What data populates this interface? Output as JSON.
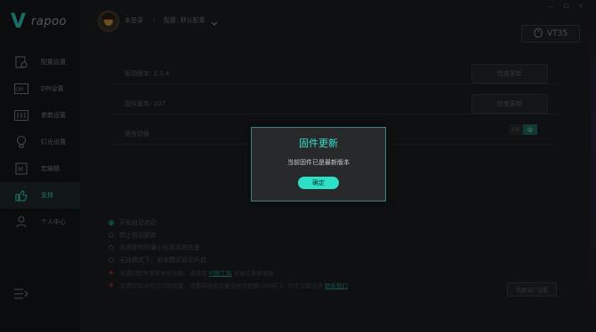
{
  "brand": {
    "logo_letter": "V",
    "logo_text": "rapoo"
  },
  "sidebar": {
    "items": [
      {
        "label": "配置设置",
        "icon": "config-icon",
        "active": false
      },
      {
        "label": "DPI设置",
        "icon": "dpi-icon",
        "active": false
      },
      {
        "label": "参数设置",
        "icon": "params-icon",
        "active": false
      },
      {
        "label": "灯光设置",
        "icon": "light-icon",
        "active": false
      },
      {
        "label": "宏编辑",
        "icon": "macro-icon",
        "active": false
      },
      {
        "label": "支持",
        "icon": "thumbs-up-icon",
        "active": true
      },
      {
        "label": "个人中心",
        "icon": "user-icon",
        "active": false
      }
    ],
    "bottom_icon": "menu-icon"
  },
  "topbar": {
    "username": "未登录",
    "separator": "|",
    "config_label": "配置: 默认配置",
    "window_controls": {
      "minimize": "—",
      "restore": "口",
      "close": "✕"
    },
    "device_name": "VT35"
  },
  "settings": {
    "driver_version_label": "驱动版本: 1.3.4",
    "driver_update_button": "检查更新",
    "firmware_version_label": "固件版本: 107",
    "firmware_update_button": "检查更新",
    "language_label": "语言切换",
    "language_options": [
      "EN",
      "中"
    ]
  },
  "options": [
    {
      "label": "开机自动启动",
      "checked": true
    },
    {
      "label": "禁止自动更新",
      "checked": false
    },
    {
      "label": "关闭软件时最小化到系统托盘",
      "checked": false
    },
    {
      "label": "无线模式下，省电模式自动开启",
      "checked": false
    }
  ],
  "notes": [
    {
      "prefix": "如遇到固件更新失败问题，请使用",
      "link": "问题工具",
      "suffix": "修复后重新更新"
    },
    {
      "prefix": "如遇到驱动无法识别设备，请重新插拔设备或尝试更换USB接口，仍无法解决请",
      "link": "联系我们",
      "suffix": ""
    }
  ],
  "restore_button": "恢复出厂设置",
  "modal": {
    "title": "固件更新",
    "message": "当前固件已是最新版本",
    "confirm": "确定"
  },
  "colors": {
    "accent": "#2ee0c8",
    "modal_border": "#3f7f85"
  }
}
